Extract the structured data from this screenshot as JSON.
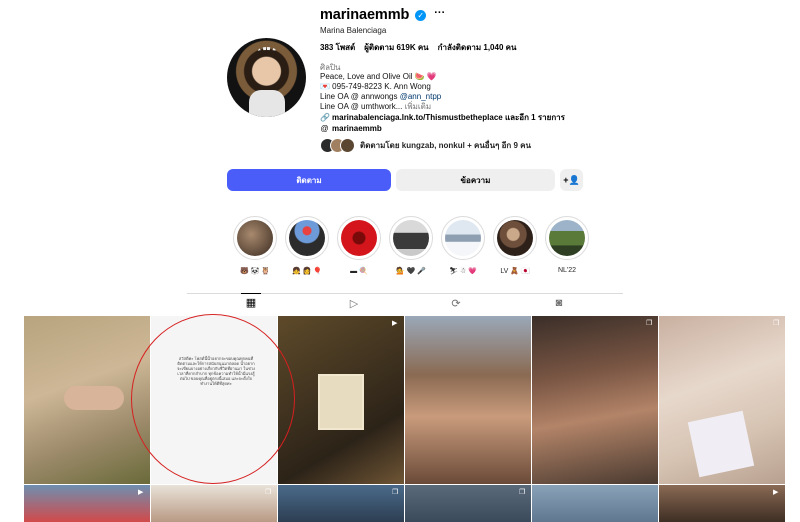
{
  "profile": {
    "username": "marinaemmb",
    "verified_icon": "verified-badge-icon",
    "more_icon": "more-options-icon",
    "full_name": "Marina Balenciaga",
    "stats": {
      "posts": "383 โพสต์",
      "followers": "ผู้ติดตาม 619K คน",
      "following": "กำลังติดตาม 1,040 คน"
    },
    "category": "ศิลปิน",
    "bio": {
      "line1": "Peace, Love and Olive Oil 🍉 💗",
      "line2_prefix": "💌 095-749-8223 K. Ann Wong",
      "line3_text": "Line OA @ annwongs ",
      "line3_handle": "@ann_ntpp",
      "line4_text": "Line OA @ umthwork... ",
      "line4_more": "เพิ่มเติม"
    },
    "link": "marinabalenciaga.lnk.to/Thismustbetheplace และอีก 1 รายการ",
    "threads": "marinaemmb",
    "followed_by": "ติดตามโดย kungzab, nonkul + คนอื่นๆ อีก 9 คน"
  },
  "actions": {
    "follow": "ติดตาม",
    "message": "ข้อความ",
    "add_user_icon": "+👤"
  },
  "highlights": [
    {
      "label": "🐻 🐼 🦉",
      "color": "#5a4636"
    },
    {
      "label": "👧 👩 🎈",
      "color": "#3b5fa8"
    },
    {
      "label": "▬ 🍭",
      "color": "#c4151c"
    },
    {
      "label": "💁 🖤 🎤",
      "color": "#8a8a8a"
    },
    {
      "label": "⛷ ☃ 💗",
      "color": "#b7c6d9"
    },
    {
      "label": "LV 🧸 🇯🇵",
      "color": "#7a5a48"
    },
    {
      "label": "NL'22",
      "color": "#3e6a2e"
    }
  ],
  "tabs": [
    {
      "icon": "grid-icon",
      "glyph": "▦"
    },
    {
      "icon": "reels-icon",
      "glyph": "▷"
    },
    {
      "icon": "reposts-icon",
      "glyph": "⟳"
    },
    {
      "icon": "tagged-icon",
      "glyph": "◙"
    }
  ],
  "posts_caption": "สวัสดีค่ะ โพสต์นี้น้ำอยากจะขอบคุณทุกคนที่ติดตามและให้การสนับสนุนมาตลอด น้ำอยากจะเขียนบางอย่างเกี่ยวกับชีวิตที่ผ่านมา ในช่วงเวลาที่ยากลำบาก ทุกข้อความทำให้น้ำมีแรงสู้ต่อไป ขอบคุณที่อยู่ตรงนี้เสมอ และจะตั้งใจทำงานให้ดีที่สุดค่ะ",
  "colors": {
    "accent": "#4a5df9",
    "link": "#00376b",
    "annotation": "#d62020"
  }
}
